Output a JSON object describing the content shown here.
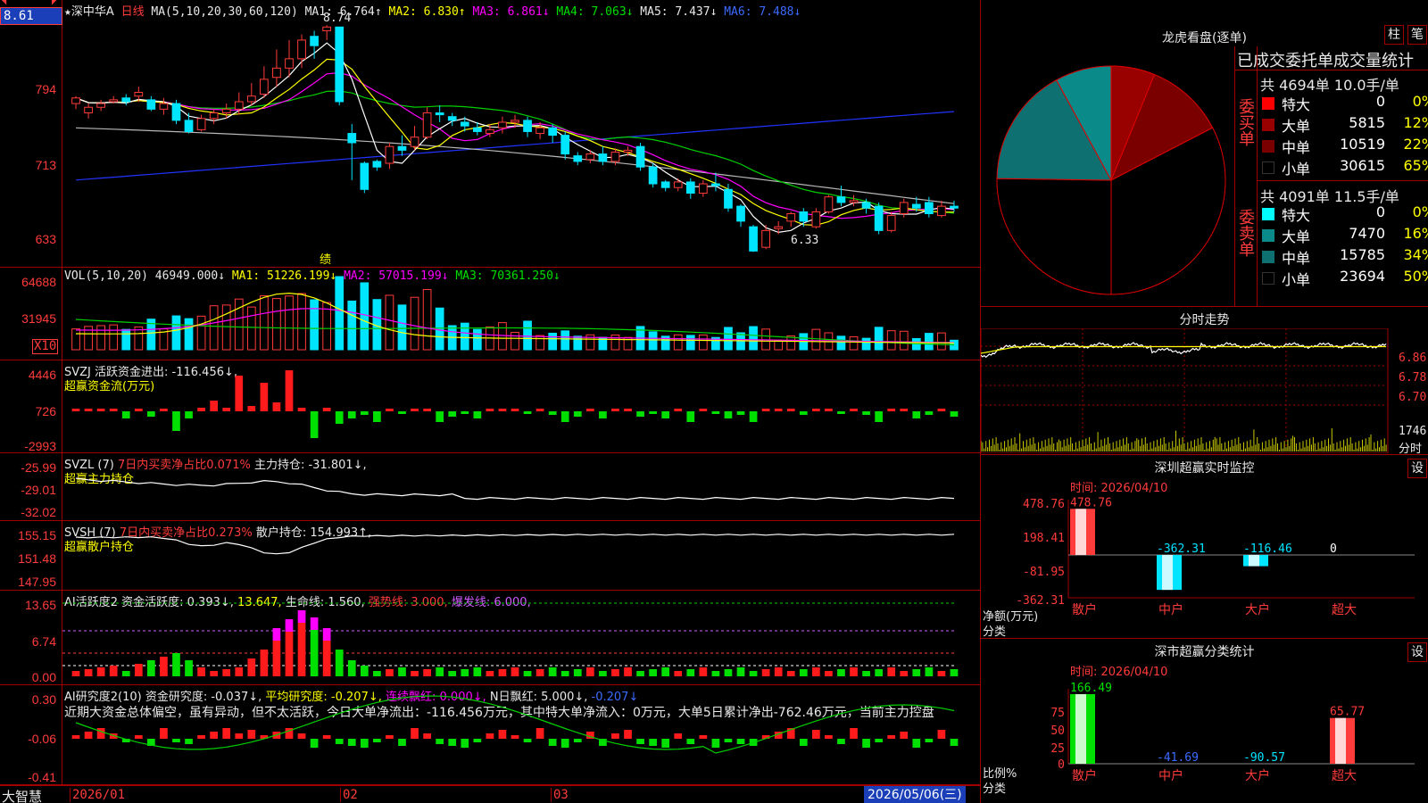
{
  "price_box": "8.61",
  "main": {
    "stock_name": "深中华A",
    "period": "日线",
    "ma_label": "MA(5,10,20,30,60,120)",
    "ma1": "MA1: 6.764↑",
    "ma2": "MA2: 6.830↑",
    "ma3": "MA3: 6.861↓",
    "ma4": "MA4: 7.063↓",
    "ma5": "MA5: 7.437↓",
    "ma6": "MA6: 7.488↓",
    "yticks": [
      "794",
      "713",
      "633"
    ],
    "hi_label": "8.74",
    "lo_label": "6.33",
    "marker": "绩"
  },
  "vol": {
    "title": "VOL(5,10,20)",
    "value": "46949.000↓",
    "ma1": "MA1: 51226.199↓",
    "ma2": "MA2: 57015.199↓",
    "ma3": "MA3: 70361.250↓",
    "yticks": [
      "64688",
      "31945"
    ],
    "unit": "X10"
  },
  "svzj": {
    "title": "SVZJ",
    "text": "活跃资金进出: -116.456↓,",
    "sub": "超赢资金流(万元)",
    "yticks": [
      "4446",
      "726",
      "-2993"
    ]
  },
  "svzl": {
    "title": "SVZL (7)",
    "t1": "7日内买卖净占比0.071%",
    "t2": "主力持仓: -31.801↓,",
    "sub": "超赢主力持仓",
    "yticks": [
      "-25.99",
      "-29.01",
      "-32.02"
    ]
  },
  "svsh": {
    "title": "SVSH (7)",
    "t1": "7日内买卖净占比0.273%",
    "t2": "散户持仓: 154.993↑,",
    "sub": "超赢散户持仓",
    "yticks": [
      "155.15",
      "151.48",
      "147.95"
    ]
  },
  "ai1": {
    "title": "AI活跃度2",
    "t1": "资金活跃度: 0.393↓,",
    "t2": "13.647,",
    "t3": "生命线: 1.560,",
    "t4": "强势线: 3.000,",
    "t5": "爆发线: 6.000,",
    "yticks": [
      "13.65",
      "6.74",
      "0.00"
    ]
  },
  "ai2": {
    "title": "AI研究度2(10)",
    "t1": "资金研究度: -0.037↓,",
    "t2": "平均研究度: -0.207↓,",
    "t3": "连续飘红: 0.000↓,",
    "t4": "N日飘红: 5.000↓,",
    "t5": "-0.207↓",
    "comment": "近期大资金总体偏空，虽有异动，但不太活跃，今日大单净流出：-116.456万元，其中特大单净流入：0万元，大单5日累计净出-762.46万元，当前主力控盘",
    "yticks": [
      "0.30",
      "-0.06",
      "-0.41"
    ]
  },
  "bottom": {
    "brand": "大智慧",
    "dates": [
      "2026/01",
      "02",
      "03"
    ],
    "current": "2026/05/06(三)"
  },
  "lhb": {
    "title": "龙虎看盘(逐单)",
    "btn1": "柱",
    "btn2": "笔",
    "subtitle": "已成交委托单成交量统计",
    "buy_label": "委买单",
    "sell_label": "委卖单",
    "buy_total": "共 4694单 10.0手/单",
    "sell_total": "共 4091单 11.5手/单",
    "buy_rows": [
      {
        "name": "特大",
        "value": "0",
        "pct": "0%",
        "color": "#ff0000"
      },
      {
        "name": "大单",
        "value": "5815",
        "pct": "12%",
        "color": "#990000"
      },
      {
        "name": "中单",
        "value": "10519",
        "pct": "22%",
        "color": "#7a0000"
      },
      {
        "name": "小单",
        "value": "30615",
        "pct": "65%",
        "color": "#000000"
      }
    ],
    "sell_rows": [
      {
        "name": "特大",
        "value": "0",
        "pct": "0%",
        "color": "#00ffff"
      },
      {
        "name": "大单",
        "value": "7470",
        "pct": "16%",
        "color": "#0b8a8a"
      },
      {
        "name": "中单",
        "value": "15785",
        "pct": "34%",
        "color": "#0e7070"
      },
      {
        "name": "小单",
        "value": "23694",
        "pct": "50%",
        "color": "#000000"
      }
    ]
  },
  "fenshi": {
    "title": "分时走势",
    "yticks": [
      "6.86",
      "6.78",
      "6.70"
    ],
    "vol_tick": "1746",
    "unit": "分时"
  },
  "szmon": {
    "title": "深圳超赢实时监控",
    "btn": "设",
    "time": "时间: 2026/04/10",
    "yticks": [
      "478.76",
      "198.41",
      "-81.95",
      "-362.31"
    ],
    "ylabel": "净额(万元)",
    "xlabel": "分类",
    "bars": [
      {
        "label": "478.76",
        "value": 478.76,
        "color": "#ff3b3b"
      },
      {
        "label": "-362.31",
        "value": -362.31,
        "color": "#00e5ff"
      },
      {
        "label": "-116.46",
        "value": -116.46,
        "color": "#00e5ff"
      },
      {
        "label": "0",
        "value": 0,
        "color": "#ffffff"
      }
    ],
    "cats": [
      "散户",
      "中户",
      "大户",
      "超大"
    ]
  },
  "szstat": {
    "title": "深市超赢分类统计",
    "btn": "设",
    "time": "时间: 2026/04/10",
    "yticks": [
      "75",
      "50",
      "25",
      "0"
    ],
    "ylabel": "比例%",
    "xlabel": "分类",
    "bars": [
      {
        "label": "166.49",
        "value": 100,
        "color": "#00e000"
      },
      {
        "label": "-41.69",
        "value": 0,
        "color": "#3b6bff"
      },
      {
        "label": "-90.57",
        "value": 0,
        "color": "#00e5ff"
      },
      {
        "label": "65.77",
        "value": 65.77,
        "color": "#ff3b3b"
      }
    ],
    "cats": [
      "散户",
      "中户",
      "大户",
      "超大"
    ]
  },
  "chart_data": [
    {
      "type": "candlestick",
      "title": "深中华A 日线",
      "ylim": [
        6.2,
        8.8
      ],
      "candles": [
        [
          7.92,
          7.98,
          7.86,
          8.0
        ],
        [
          7.82,
          7.88,
          7.76,
          7.92
        ],
        [
          7.88,
          7.92,
          7.84,
          7.96
        ],
        [
          7.94,
          7.96,
          7.92,
          8.0
        ],
        [
          7.98,
          7.94,
          7.9,
          8.02
        ],
        [
          8.0,
          8.04,
          7.94,
          8.1
        ],
        [
          7.96,
          7.86,
          7.84,
          8.0
        ],
        [
          7.86,
          7.92,
          7.8,
          7.98
        ],
        [
          7.92,
          7.74,
          7.7,
          7.96
        ],
        [
          7.74,
          7.62,
          7.6,
          7.82
        ],
        [
          7.64,
          7.76,
          7.62,
          7.8
        ],
        [
          7.76,
          7.82,
          7.7,
          7.86
        ],
        [
          7.82,
          7.86,
          7.76,
          7.92
        ],
        [
          7.86,
          7.94,
          7.8,
          8.04
        ],
        [
          7.94,
          8.0,
          7.9,
          8.14
        ],
        [
          8.02,
          8.18,
          7.98,
          8.32
        ],
        [
          8.2,
          8.3,
          8.1,
          8.5
        ],
        [
          8.3,
          8.4,
          8.2,
          8.6
        ],
        [
          8.4,
          8.6,
          8.3,
          8.66
        ],
        [
          8.64,
          8.54,
          8.4,
          8.7
        ],
        [
          8.7,
          8.74,
          8.6,
          8.76
        ],
        [
          8.74,
          7.94,
          7.9,
          8.74
        ],
        [
          7.6,
          7.5,
          7.1,
          7.7
        ],
        [
          7.28,
          7.0,
          6.96,
          7.3
        ],
        [
          7.3,
          7.24,
          7.2,
          7.32
        ],
        [
          7.28,
          7.46,
          7.22,
          7.5
        ],
        [
          7.46,
          7.42,
          7.36,
          7.58
        ],
        [
          7.46,
          7.56,
          7.42,
          7.68
        ],
        [
          7.56,
          7.82,
          7.54,
          7.88
        ],
        [
          7.82,
          7.8,
          7.72,
          7.9
        ],
        [
          7.78,
          7.74,
          7.68,
          7.82
        ],
        [
          7.72,
          7.68,
          7.62,
          7.78
        ],
        [
          7.66,
          7.62,
          7.58,
          7.72
        ],
        [
          7.6,
          7.64,
          7.56,
          7.7
        ],
        [
          7.66,
          7.72,
          7.6,
          7.78
        ],
        [
          7.72,
          7.74,
          7.66,
          7.8
        ],
        [
          7.74,
          7.62,
          7.56,
          7.78
        ],
        [
          7.6,
          7.66,
          7.54,
          7.72
        ],
        [
          7.66,
          7.58,
          7.5,
          7.7
        ],
        [
          7.58,
          7.38,
          7.32,
          7.62
        ],
        [
          7.36,
          7.3,
          7.26,
          7.4
        ],
        [
          7.32,
          7.38,
          7.28,
          7.42
        ],
        [
          7.38,
          7.3,
          7.26,
          7.46
        ],
        [
          7.3,
          7.4,
          7.26,
          7.44
        ],
        [
          7.4,
          7.42,
          7.36,
          7.46
        ],
        [
          7.46,
          7.24,
          7.2,
          7.5
        ],
        [
          7.24,
          7.06,
          7.02,
          7.28
        ],
        [
          7.08,
          7.02,
          6.98,
          7.1
        ],
        [
          7.02,
          7.08,
          6.98,
          7.12
        ],
        [
          7.08,
          6.96,
          6.9,
          7.12
        ],
        [
          6.96,
          7.06,
          6.92,
          7.1
        ],
        [
          7.06,
          7.04,
          6.98,
          7.18
        ],
        [
          7.0,
          6.8,
          6.76,
          7.06
        ],
        [
          6.82,
          6.66,
          6.6,
          6.84
        ],
        [
          6.6,
          6.34,
          6.33,
          6.62
        ],
        [
          6.38,
          6.56,
          6.36,
          6.62
        ],
        [
          6.58,
          6.6,
          6.52,
          6.66
        ],
        [
          6.66,
          6.74,
          6.6,
          6.76
        ],
        [
          6.76,
          6.66,
          6.6,
          6.8
        ],
        [
          6.6,
          6.76,
          6.58,
          6.8
        ],
        [
          6.76,
          6.92,
          6.74,
          6.94
        ],
        [
          6.92,
          6.86,
          6.82,
          7.04
        ],
        [
          6.86,
          6.88,
          6.82,
          6.94
        ],
        [
          6.86,
          6.8,
          6.74,
          6.9
        ],
        [
          6.82,
          6.56,
          6.52,
          6.86
        ],
        [
          6.56,
          6.72,
          6.54,
          6.76
        ],
        [
          6.74,
          6.86,
          6.7,
          6.9
        ],
        [
          6.84,
          6.8,
          6.76,
          6.92
        ],
        [
          6.86,
          6.74,
          6.7,
          6.92
        ],
        [
          6.72,
          6.82,
          6.7,
          6.88
        ],
        [
          6.82,
          6.8,
          6.76,
          6.88
        ]
      ]
    }
  ]
}
